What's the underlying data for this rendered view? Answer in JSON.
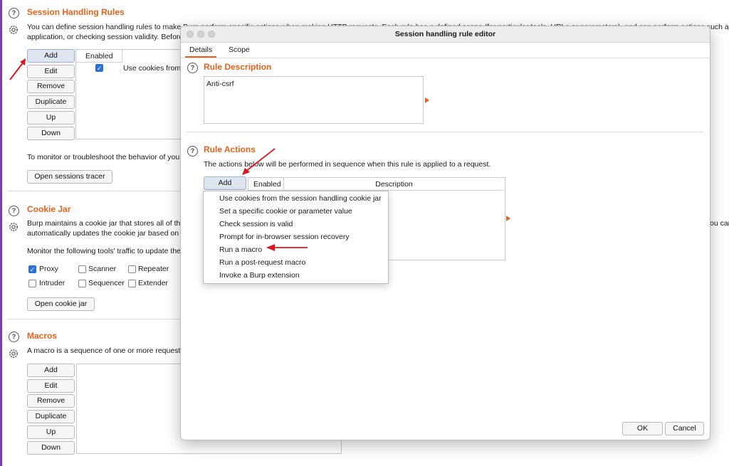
{
  "session_rules": {
    "title": "Session Handling Rules",
    "description_line1": "You can define session handling rules to make Burp perform specific actions when making HTTP requests. Each rule has a defined scope (for particular tools, URLs or parameters), and can perform actions such as add",
    "description_line2": "application, or checking session validity. Before",
    "buttons": [
      "Add",
      "Edit",
      "Remove",
      "Duplicate",
      "Up",
      "Down"
    ],
    "table_header": "Enabled",
    "row_text": "Use cookies from",
    "tracer_text": "To monitor or troubleshoot the behavior of your s",
    "tracer_button": "Open sessions tracer"
  },
  "cookie_jar": {
    "title": "Cookie Jar",
    "description_line1": "Burp maintains a cookie jar that stores all of the",
    "description_line2": "automatically updates the cookie jar based on t",
    "right_fragment": "ou car",
    "monitor_text": "Monitor the following tools' traffic to update the",
    "tools": [
      {
        "label": "Proxy",
        "checked": true
      },
      {
        "label": "Scanner",
        "checked": false
      },
      {
        "label": "Repeater",
        "checked": false
      },
      {
        "label": "Intruder",
        "checked": false
      },
      {
        "label": "Sequencer",
        "checked": false
      },
      {
        "label": "Extender",
        "checked": false
      }
    ],
    "open_button": "Open cookie jar"
  },
  "macros": {
    "title": "Macros",
    "description": "A macro is a sequence of one or more requests",
    "buttons": [
      "Add",
      "Edit",
      "Remove",
      "Duplicate",
      "Up",
      "Down"
    ]
  },
  "dialog": {
    "title": "Session handling rule editor",
    "tabs": [
      "Details",
      "Scope"
    ],
    "rule_description": {
      "title": "Rule Description",
      "value": "Anti-csrf"
    },
    "rule_actions": {
      "title": "Rule Actions",
      "description": "The actions below will be performed in sequence when this rule is applied to a request.",
      "add_button": "Add",
      "col_enabled": "Enabled",
      "col_description": "Description",
      "menu": [
        "Use cookies from the session handling cookie jar",
        "Set a specific cookie or parameter value",
        "Check session is valid",
        "Prompt for in-browser session recovery",
        "Run a macro",
        "Run a post-request macro",
        "Invoke a Burp extension"
      ]
    },
    "ok_button": "OK",
    "cancel_button": "Cancel"
  },
  "colors": {
    "accent": "#e8621c",
    "annotation_arrow": "#e0141e",
    "checkbox_blue": "#2d6fd6"
  }
}
